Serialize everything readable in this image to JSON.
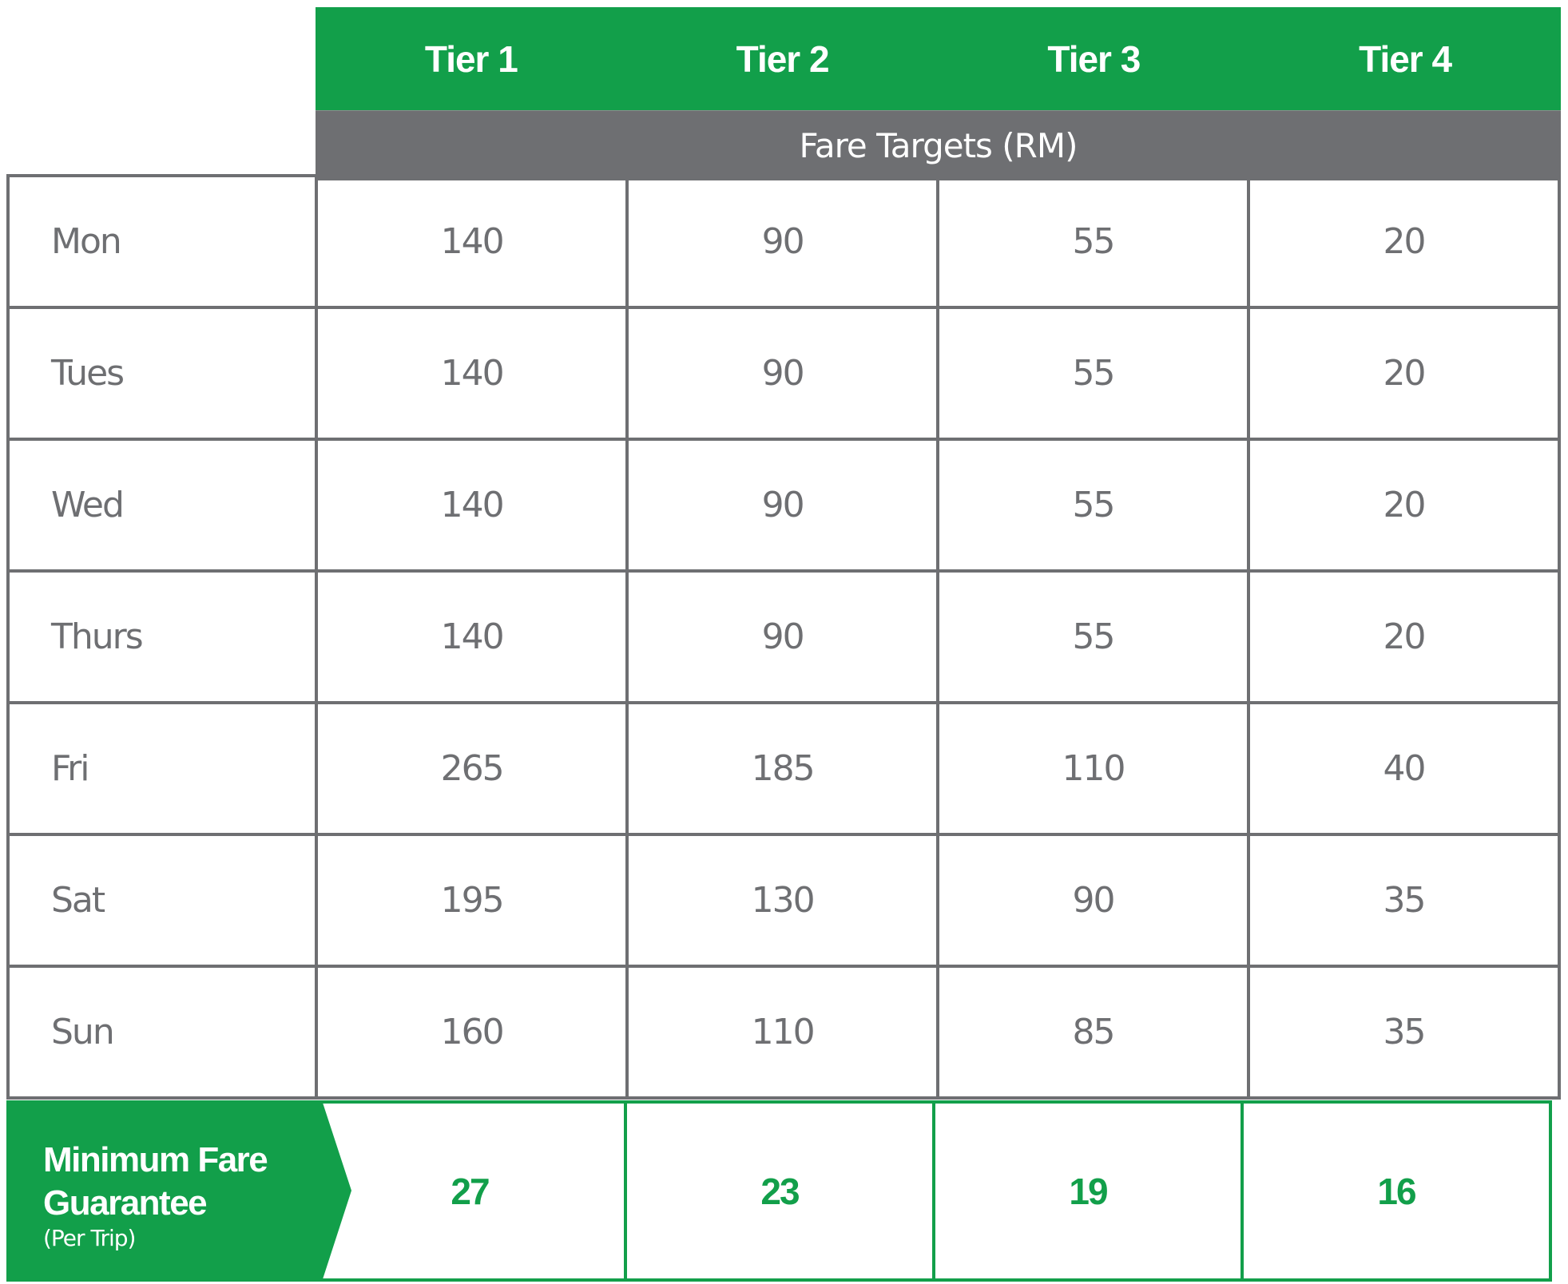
{
  "header": {
    "tiers": [
      "Tier 1",
      "Tier 2",
      "Tier 3",
      "Tier 4"
    ],
    "subheader": "Fare Targets  (RM)"
  },
  "colors": {
    "brand_green": "#129f4a",
    "header_gray": "#6e6f72",
    "text_gray": "#6e6f72"
  },
  "rows": [
    {
      "day": "Mon",
      "values": [
        "140",
        "90",
        "55",
        "20"
      ]
    },
    {
      "day": "Tues",
      "values": [
        "140",
        "90",
        "55",
        "20"
      ]
    },
    {
      "day": "Wed",
      "values": [
        "140",
        "90",
        "55",
        "20"
      ]
    },
    {
      "day": "Thurs",
      "values": [
        "140",
        "90",
        "55",
        "20"
      ]
    },
    {
      "day": "Fri",
      "values": [
        "265",
        "185",
        "110",
        "40"
      ]
    },
    {
      "day": "Sat",
      "values": [
        "195",
        "130",
        "90",
        "35"
      ]
    },
    {
      "day": "Sun",
      "values": [
        "160",
        "110",
        "85",
        "35"
      ]
    }
  ],
  "minimum_fare": {
    "title_line1": "Minimum Fare",
    "title_line2": "Guarantee",
    "subtitle": "(Per Trip)",
    "values": [
      "27",
      "23",
      "19",
      "16"
    ]
  },
  "chart_data": {
    "type": "table",
    "title": "Fare Targets (RM)",
    "columns": [
      "",
      "Tier 1",
      "Tier 2",
      "Tier 3",
      "Tier 4"
    ],
    "rows": [
      [
        "Mon",
        140,
        90,
        55,
        20
      ],
      [
        "Tues",
        140,
        90,
        55,
        20
      ],
      [
        "Wed",
        140,
        90,
        55,
        20
      ],
      [
        "Thurs",
        140,
        90,
        55,
        20
      ],
      [
        "Fri",
        265,
        185,
        110,
        40
      ],
      [
        "Sat",
        195,
        130,
        90,
        35
      ],
      [
        "Sun",
        160,
        110,
        85,
        35
      ],
      [
        "Minimum Fare Guarantee (Per Trip)",
        27,
        23,
        19,
        16
      ]
    ]
  }
}
